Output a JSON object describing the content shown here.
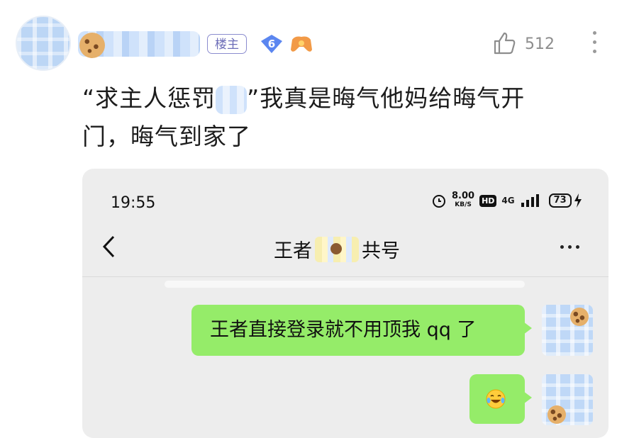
{
  "post": {
    "op_badge": "楼主",
    "level": "6",
    "like_count": "512",
    "text_line1_open": "“求主人惩罚",
    "text_line1_rest": "”我真是晦气他妈给晦气开",
    "text_line2": "门，晦气到家了"
  },
  "screenshot": {
    "status_time": "19:55",
    "net_speed": "8.00",
    "net_unit": "KB/S",
    "hd_label": "HD",
    "network": "4G",
    "battery": "73",
    "chat_title_left": "王者",
    "chat_title_right": "共号",
    "messages": [
      {
        "text": "王者直接登录就不用顶我 qq 了"
      },
      {
        "emoji": "laugh-cry-emoji"
      }
    ]
  },
  "colors": {
    "bubble": "#95ec69",
    "chat_bg": "#ededed",
    "op_badge": "#6c6db8",
    "level_badge": "#5b86f0"
  },
  "icons": [
    "like-icon",
    "more-vertical-icon",
    "back-icon",
    "more-horizontal-icon",
    "alarm-icon",
    "signal-icon",
    "battery-icon"
  ]
}
